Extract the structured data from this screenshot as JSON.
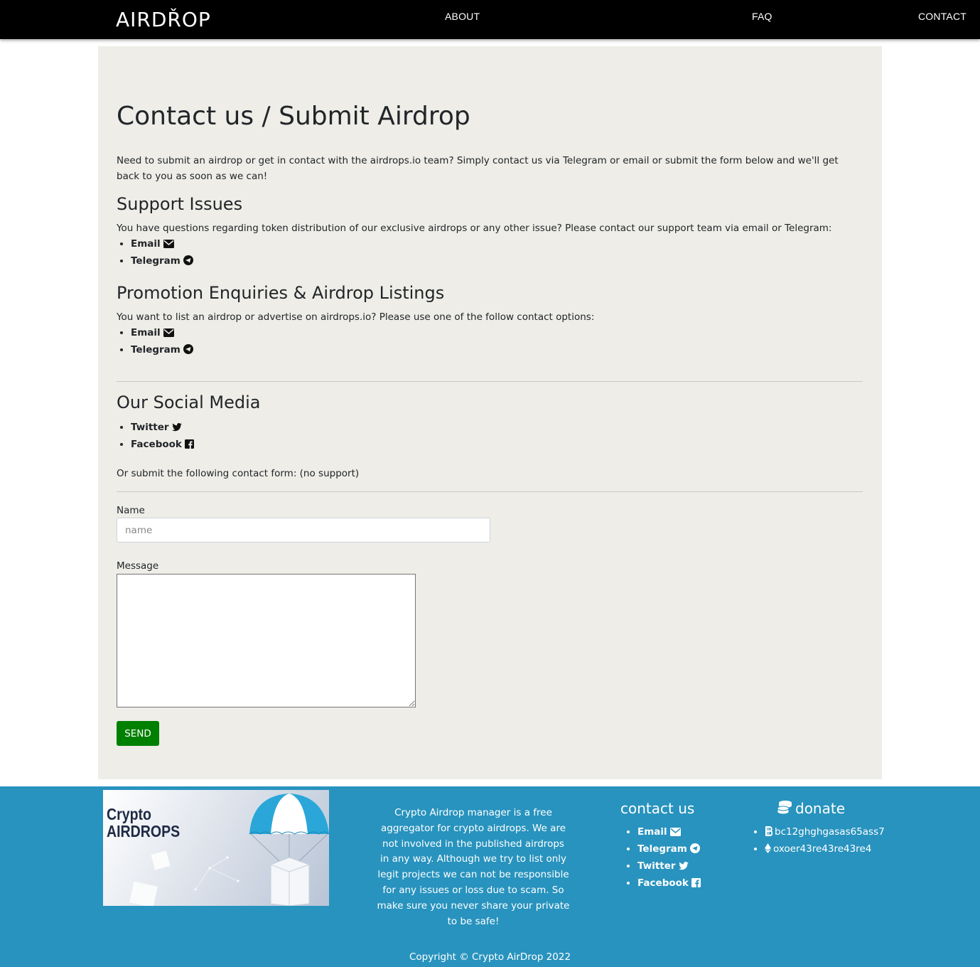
{
  "nav": {
    "logo": "AIRDŘOP",
    "items": [
      "ABOUT",
      "FAQ",
      "CONTACT"
    ]
  },
  "page": {
    "title": "Contact us / Submit Airdrop",
    "intro": "Need to submit an airdrop or get in contact with the airdrops.io team? Simply contact us via Telegram or email or submit the form below and we'll get back to you as soon as we can!"
  },
  "support": {
    "heading": "Support Issues",
    "text": "You have questions regarding token distribution of our exclusive airdrops or any other issue? Please contact our support team via email or Telegram:",
    "links": [
      "Email",
      "Telegram"
    ]
  },
  "promotion": {
    "heading": "Promotion Enquiries & Airdrop Listings",
    "text": "You want to list an airdrop or advertise on airdrops.io? Please use one of the follow contact options:",
    "links": [
      "Email",
      "Telegram"
    ]
  },
  "social": {
    "heading": "Our Social Media",
    "links": [
      "Twitter",
      "Facebook"
    ]
  },
  "form": {
    "intro": "Or submit the following contact form: (no support)",
    "name_label": "Name",
    "name_placeholder": "name",
    "message_label": "Message",
    "send_label": "SEND"
  },
  "footer": {
    "image_text": [
      "Crypto",
      "AIRDROPS"
    ],
    "about": "Crypto Airdrop manager is a free aggregator for crypto airdrops. We are not involved in the published airdrops in any way. Although we try to list only legit projects we can not be responsible for any issues or loss due to scam. So make sure you never share your private to be safe!",
    "contact_heading": "contact us",
    "contact_links": [
      "Email",
      "Telegram",
      "Twitter",
      "Facebook"
    ],
    "donate_heading": "donate",
    "donate_items": [
      "bc12ghghgasas65ass7",
      "oxoer43re43re43re4"
    ],
    "copyright": "Copyright © Crypto AirDrop 2022"
  },
  "colors": {
    "nav_bg": "#000000",
    "main_bg": "#eeede7",
    "footer_bg": "#2893be",
    "send_button": "#008000"
  },
  "icons": {
    "email": "envelope-icon",
    "telegram": "telegram-icon",
    "twitter": "twitter-icon",
    "facebook": "facebook-icon",
    "donate": "coins-icon",
    "bitcoin": "bitcoin-icon",
    "ethereum": "ethereum-icon"
  }
}
